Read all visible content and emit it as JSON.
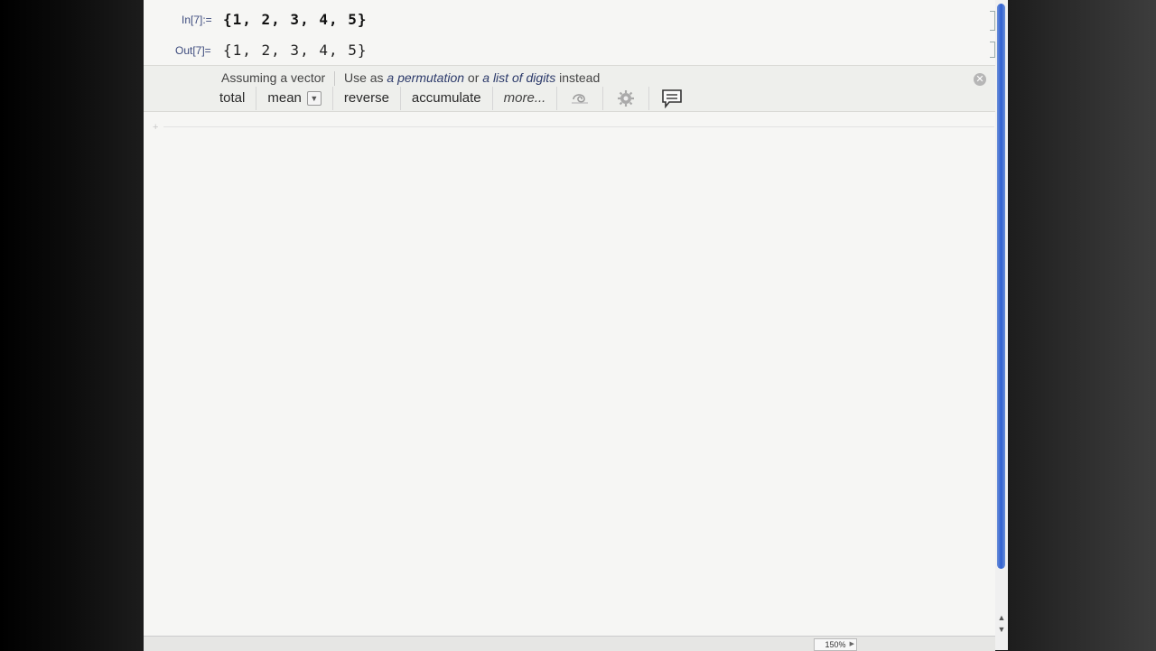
{
  "cells": {
    "in_label": "In[7]:=",
    "in_content": "{1, 2, 3, 4, 5}",
    "out_label": "Out[7]=",
    "out_content": "{1, 2, 3, 4, 5}"
  },
  "suggestions": {
    "assuming": "Assuming a vector",
    "use_as": "Use as",
    "option1": "a permutation",
    "or": "or",
    "option2": "a list of digits",
    "instead": "instead",
    "actions": {
      "total": "total",
      "mean": "mean",
      "reverse": "reverse",
      "accumulate": "accumulate",
      "more": "more..."
    },
    "icons": [
      "swirl-icon",
      "gear-icon",
      "chat-icon"
    ]
  },
  "status": {
    "zoom": "150%"
  },
  "colors": {
    "accent": "#2e5fd1",
    "label": "#3e4c7e"
  }
}
